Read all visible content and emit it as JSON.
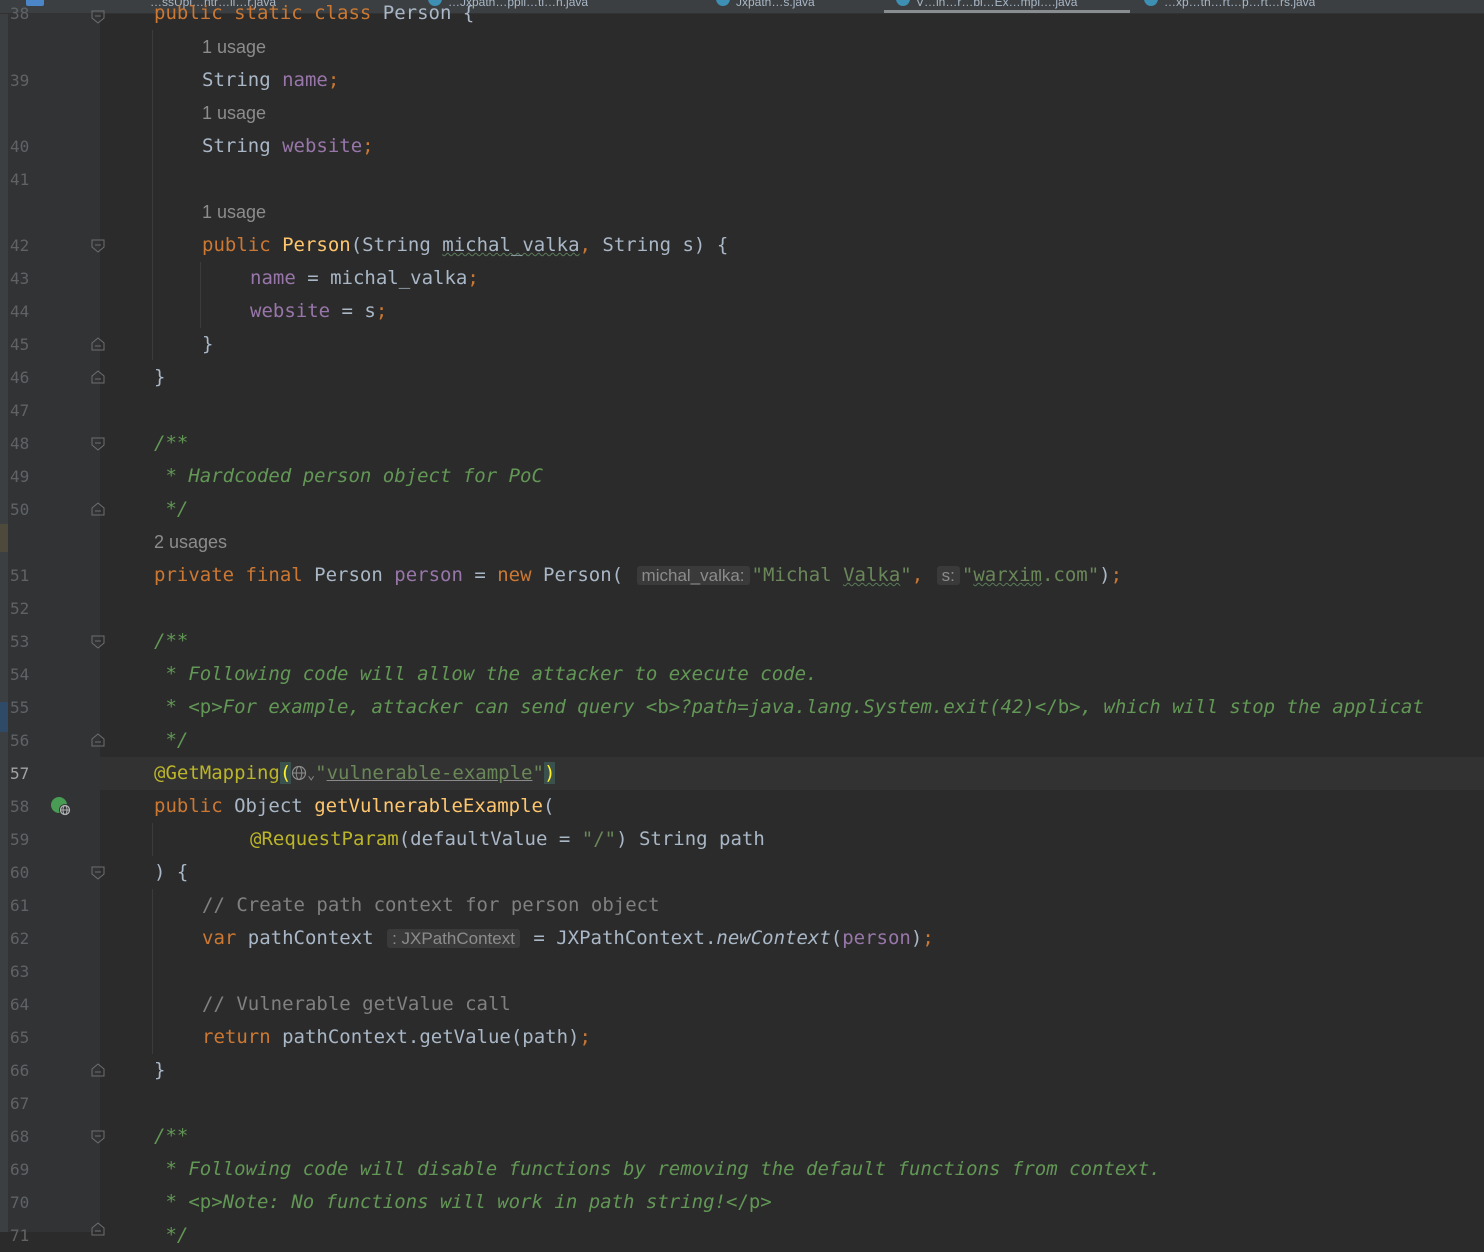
{
  "tabs": [
    {
      "label": "…ssUpl…ntr…ll…r.java"
    },
    {
      "label": "…Jxpath…ppli…ti…n.java"
    },
    {
      "label": "Jxpath…s.java"
    },
    {
      "label": "V…ln…r…bl…Ex…mpl….java"
    },
    {
      "label": "…xp…th…rt…p…rt…rs.java"
    }
  ],
  "editor": {
    "current_line": 57,
    "inlay": {
      "usage1": "1 usage",
      "usage2": "1 usage",
      "usage3": "1 usage",
      "usages2": "2 usages",
      "param_michal": "michal_valka:",
      "param_s": "s:",
      "type_hint": ": JXPathContext"
    },
    "code": {
      "l38": "public static class Person {",
      "l39_type": "String",
      "l39_name": "name",
      "l40_type": "String",
      "l40_name": "website",
      "l42_kw": "public",
      "l42_ctor": "Person",
      "l42_params": "(String michal_valka, String s) {",
      "l43_field": "name",
      "l43_rest": " = michal_valka",
      "l44_field": "website",
      "l44_rest": " = s",
      "l45": "}",
      "l46": "}",
      "l48": "/**",
      "l49": " * Hardcoded person object for PoC",
      "l50": " */",
      "l51_kw": "private final",
      "l51_type": "Person",
      "l51_field": "person",
      "l51_new": "new",
      "l51_call": "Person(",
      "l51_str1": "\"Michal Valka\"",
      "l51_str2": "\"warxim.com\"",
      "l53": "/**",
      "l54": " * Following code will allow the attacker to execute code.",
      "l55_a": " * ",
      "l55_p": "<p>",
      "l55_b": "For example, attacker can send query ",
      "l55_bt": "<b>",
      "l55_c": "?path=java.lang.System.exit(42)",
      "l55_bc": "</b>",
      "l55_d": ", which will stop the applicat",
      "l56": " */",
      "l57_ann": "@GetMapping",
      "l57_str": "vulnerable-example",
      "l58_kw": "public",
      "l58_type": "Object",
      "l58_fn": "getVulnerableExample",
      "l59_ann": "@RequestParam",
      "l59_a": "(defaultValue = ",
      "l59_str": "\"/\"",
      "l59_b": ") String path",
      "l60": ") {",
      "l61": "// Create path context for person object",
      "l62_kw": "var",
      "l62_a": "pathContext",
      "l62_b": " = JXPathContext.",
      "l62_m": "newContext",
      "l62_arg": "person",
      "l64": "// Vulnerable getValue call",
      "l65_kw": "return",
      "l65_rest": " pathContext.getValue(path)",
      "l66": "}",
      "l68": "/**",
      "l69": " * Following code will disable functions by removing the default functions from context.",
      "l70_a": " * ",
      "l70_p": "<p>",
      "l70_b": "Note: No functions will work in path string!",
      "l70_pc": "</p>",
      "l71": " */"
    }
  },
  "colors": {
    "background": "#2b2b2b",
    "keyword": "#cc7832",
    "field": "#9876aa",
    "method": "#ffc66d",
    "string": "#6a8759",
    "annotation": "#bbb529",
    "doc_comment": "#629755",
    "line_comment": "#808080"
  }
}
